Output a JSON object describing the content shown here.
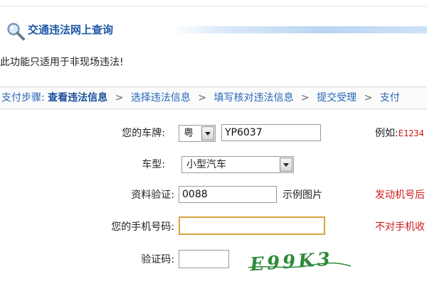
{
  "header": {
    "title": "交通违法网上查询",
    "icon": "search-icon"
  },
  "notice": "此功能只适用于非现场违法!",
  "steps": {
    "label": "支付步骤:",
    "items": [
      {
        "label": "查看违法信息",
        "current": true
      },
      {
        "label": "选择违法信息",
        "current": false
      },
      {
        "label": "填写核对违法信息",
        "current": false
      },
      {
        "label": "提交受理",
        "current": false
      },
      {
        "label": "支付",
        "current": false
      }
    ]
  },
  "form": {
    "plate": {
      "label": "您的车牌:",
      "province": "粤",
      "number": "YP6037",
      "example_label": "例如:",
      "example_code": "E1234"
    },
    "vehicle_type": {
      "label": "车型:",
      "value": "小型汽车"
    },
    "verification": {
      "label": "资料验证:",
      "value": "0088",
      "sample_link": "示例图片",
      "hint": "发动机号后"
    },
    "phone": {
      "label": "您的手机号码:",
      "value": "",
      "hint": "不对手机收"
    },
    "captcha": {
      "label": "验证码:",
      "value": "",
      "image_text": "E99K3"
    }
  },
  "colors": {
    "title": "#1e58a6",
    "steps": "#2766b8",
    "hint": "#d01a1a",
    "captcha": "#2f8a3b",
    "focus_border": "#d9a43a"
  }
}
